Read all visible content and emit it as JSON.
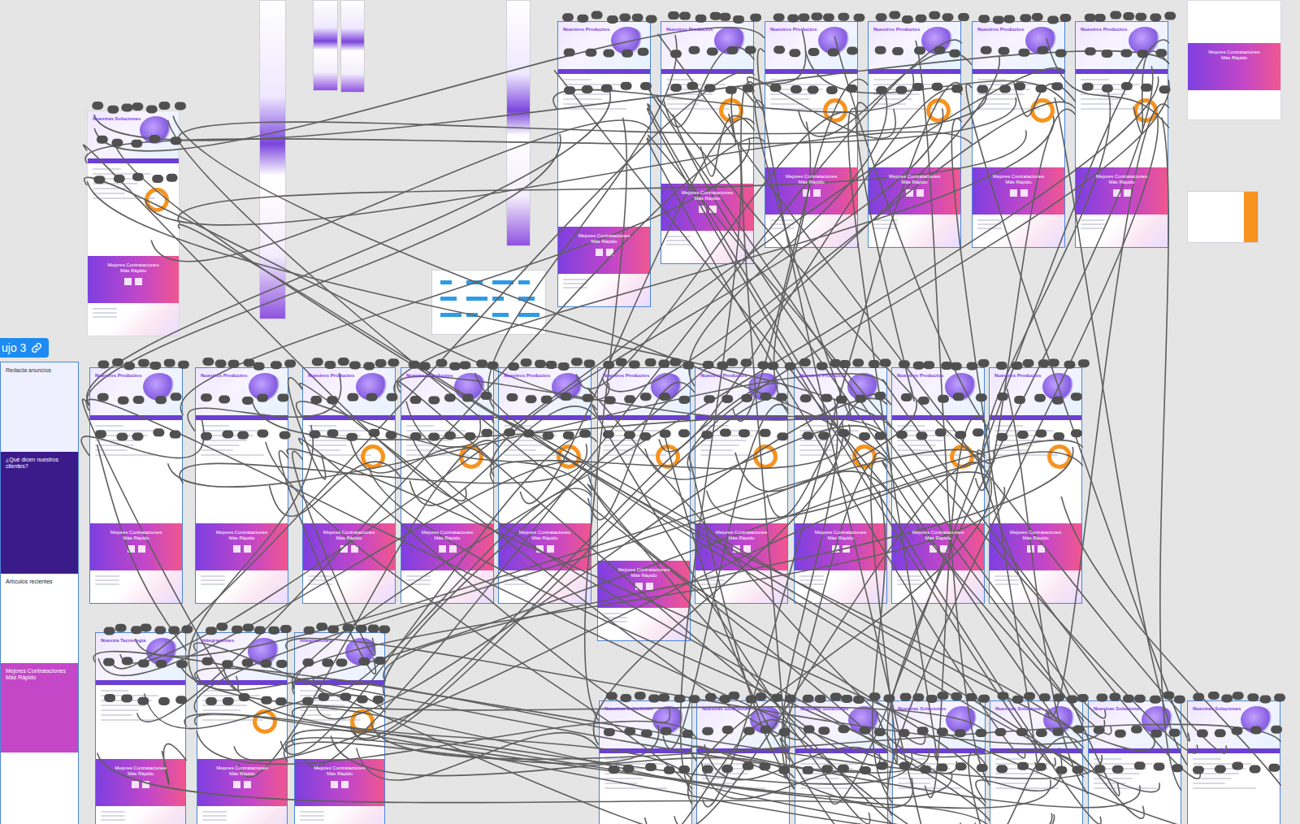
{
  "flow_label": {
    "text": "ujo 3",
    "icon": "link"
  },
  "top_left": {
    "heading": "Nuestras Soluciones",
    "banner": "Mejores Contrataciones Más Rápido",
    "selected": false
  },
  "top_row": [
    {
      "heading": "Nuestros Productos",
      "banner": "Mejores Contrataciones Más Rápido",
      "selected": true
    },
    {
      "heading": "Nuestros Productos",
      "banner": "Mejores Contrataciones Más Rápido",
      "selected": true
    },
    {
      "heading": "Nuestros Productos",
      "banner": "Mejores Contrataciones Más Rápido",
      "selected": true
    },
    {
      "heading": "Nuestros Productos",
      "banner": "Mejores Contrataciones Más Rápido",
      "selected": true
    },
    {
      "heading": "Nuestros Productos",
      "banner": "Mejores Contrataciones Más Rápido",
      "selected": true
    },
    {
      "heading": "Nuestros Productos",
      "banner": "Mejores Contrataciones Más Rápido",
      "selected": true
    }
  ],
  "middle_row": [
    {
      "heading": "Nuestros Productos",
      "banner": "Mejores Contrataciones Más Rápido",
      "selected": true
    },
    {
      "heading": "Nuestros Productos",
      "banner": "Mejores Contrataciones Más Rápido",
      "selected": true
    },
    {
      "heading": "Nuestros Productos",
      "banner": "Mejores Contrataciones Más Rápido",
      "selected": true
    },
    {
      "heading": "Nuestros Productos",
      "banner": "Mejores Contrataciones Más Rápido",
      "selected": true
    },
    {
      "heading": "Nuestros Productos",
      "banner": "Mejores Contrataciones Más Rápido",
      "selected": true
    },
    {
      "heading": "Nuestros Productos",
      "banner": "Mejores Contrataciones Más Rápido",
      "selected": true
    },
    {
      "heading": "Nuestros Productos",
      "banner": "Mejores Contrataciones Más Rápido",
      "selected": true
    },
    {
      "heading": "Nuestros Productos",
      "banner": "Mejores Contrataciones Más Rápido",
      "selected": true
    },
    {
      "heading": "Nuestros Productos",
      "banner": "Mejores Contrataciones Más Rápido",
      "selected": true
    },
    {
      "heading": "Nuestros Productos",
      "banner": "Mejores Contrataciones Más Rápido",
      "selected": true
    }
  ],
  "bottom_left": [
    {
      "heading": "Nuestra Tecnología",
      "banner": "Mejores Contrataciones Más Rápido",
      "selected": true
    },
    {
      "heading": "Integraciones",
      "banner": "Mejores Contrataciones Más Rápido",
      "selected": true
    },
    {
      "heading": "Integraciones",
      "banner": "Mejores Contrataciones Más Rápido",
      "selected": true
    }
  ],
  "bottom_row": [
    {
      "heading": "Nuestras Soluciones",
      "selected": true
    },
    {
      "heading": "Nuestras Soluciones",
      "selected": true
    },
    {
      "heading": "Nuestras Soluciones",
      "selected": true
    },
    {
      "heading": "Nuestras Soluciones",
      "selected": true
    },
    {
      "heading": "Nuestras Soluciones",
      "selected": true
    },
    {
      "heading": "Nuestras Soluciones",
      "selected": true
    },
    {
      "heading": "Nuestras Soluciones",
      "selected": true
    }
  ],
  "left_column": {
    "sections": [
      "Redacta anuncios",
      "¿Qué dicen nuestros clientes?",
      "Artículos recientes",
      "Mejores Contrataciones Más Rápido"
    ]
  },
  "right_card": {
    "banner": "Mejores Contrataciones Más Rápido"
  }
}
